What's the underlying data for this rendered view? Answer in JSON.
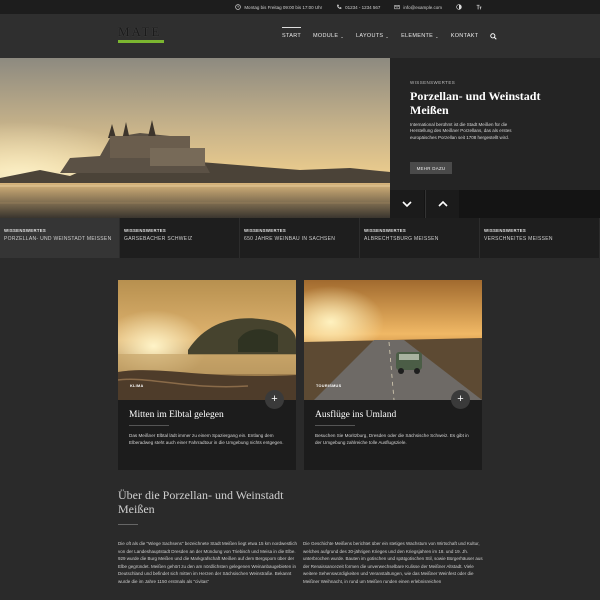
{
  "topbar": {
    "hours": "Montag bis Freitag 09:00 bis 17:00 Uhr",
    "phone": "01234 - 1234 567",
    "email": "info@example.com"
  },
  "header": {
    "logo_text": "MATE",
    "brand_color": "#7bb630",
    "nav": [
      {
        "label": "START",
        "active": true,
        "caret": false
      },
      {
        "label": "MODULE",
        "active": false,
        "caret": true
      },
      {
        "label": "LAYOUTS",
        "active": false,
        "caret": true
      },
      {
        "label": "ELEMENTE",
        "active": false,
        "caret": true
      },
      {
        "label": "KONTAKT",
        "active": false,
        "caret": false
      }
    ]
  },
  "hero": {
    "kicker": "WISSENSWERTES",
    "title": "Porzellan- und Weinstadt Meißen",
    "description": "International berühmt ist die Stadt Meißen für die Herstellung des Meißner Porzellans, das als erstes europäisches Porzellan seit 1708 hergestellt wird.",
    "button": "MEHR DAZU"
  },
  "tabs": [
    {
      "kicker": "WISSENSWERTES",
      "title": "PORZELLAN- UND WEINSTADT MEISSEN",
      "active": true
    },
    {
      "kicker": "WISSENSWERTES",
      "title": "GARSEBACHER SCHWEIZ",
      "active": false
    },
    {
      "kicker": "WISSENSWERTES",
      "title": "650 JAHRE WEINBAU IN SACHSEN",
      "active": false
    },
    {
      "kicker": "WISSENSWERTES",
      "title": "ALBRECHTSBURG MEISSEN",
      "active": false
    },
    {
      "kicker": "WISSENSWERTES",
      "title": "VERSCHNEITES MEISSEN",
      "active": false
    }
  ],
  "cards": [
    {
      "badge": "KLIMA",
      "title": "Mitten im Elbtal gelegen",
      "description": "Das Meißner Elbtal lädt immer zu einem Spaziergang ein. Entlang dem Elberadweg steht auch einer Fahrradtour in die Umgebung nichts entgegen."
    },
    {
      "badge": "TOURISMUS",
      "title": "Ausflüge ins Umland",
      "description": "Besuchen Sie Moritzburg, Dresden oder die Sächsische Schweiz. Es gibt in der Umgebung zahlreiche tolle Ausflugsziele."
    }
  ],
  "about": {
    "title": "Über die Porzellan- und Weinstadt Meißen",
    "col1": "Die oft als die \"Wiege Sachsens\" bezeichnete Stadt Meißen liegt etwa 15 km nordwestlich von der Landeshauptstadt Dresden an der Mündung von Triebisch und Meisa in die Elbe. 929 wurde die Burg Meißen und die Markgrafschaft Meißen auf dem Bergsporn über der Elbe gegründet. Meißen gehört zu den am nördlichsten gelegenen Weinanbaugebieten in Deutschland und befindet sich mitten im Herzen der Sächsischen Weinstraße. Bekannt wurde die im Jahre 1150 erstmals als \"civitas\"",
    "col2": "Die Geschichte Meißens berichtet über ein stetiges Wachstum von Wirtschaft und Kultur, welches aufgrund des 30-jährigen Krieges und den Kriegsjahren im 18. und 19. Jh. unterbrochen wurde. Bauten im gotischen und spätgotischen Stil, sowie Bürgerhäuser aus der Renaissancezeit formen die unverwechselbare Kulisse der Meißner Altstadt. Viele weitere Sehenswürdigkeiten und Veranstaltungen, wie das Meißner Weinfest oder die Meißner Weihnacht, in rund um Meißen runden einen erlebnisreichen"
  }
}
